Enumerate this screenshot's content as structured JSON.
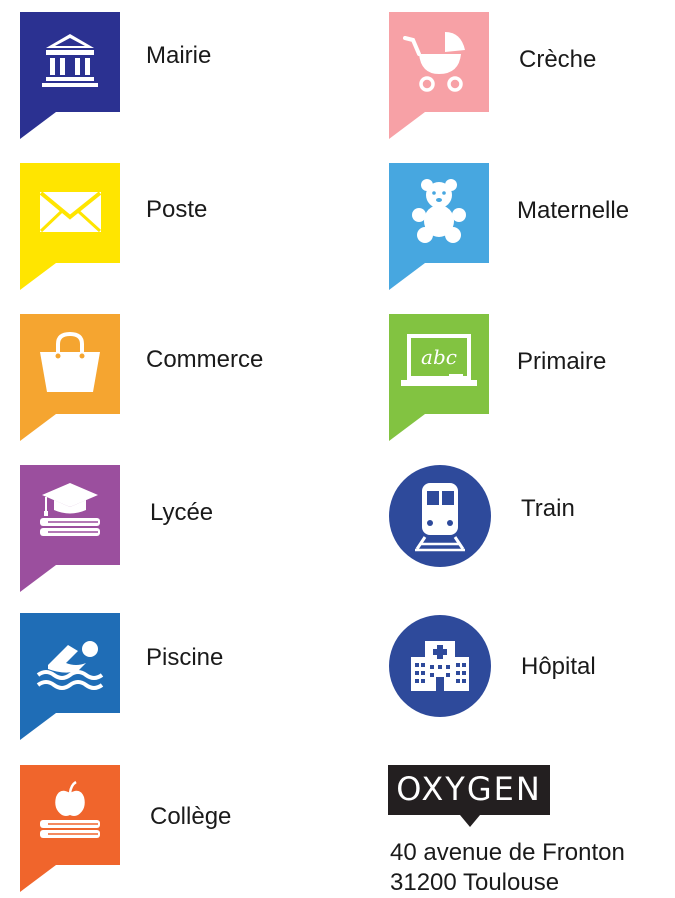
{
  "legend": {
    "left_column": [
      {
        "label": "Mairie",
        "icon": "city-hall-icon",
        "color": "#2b3191"
      },
      {
        "label": "Poste",
        "icon": "envelope-icon",
        "color": "#ffe500"
      },
      {
        "label": "Commerce",
        "icon": "shopping-bag-icon",
        "color": "#f5a530"
      },
      {
        "label": "Lycée",
        "icon": "graduation-books-icon",
        "color": "#9b4f9e"
      },
      {
        "label": "Piscine",
        "icon": "swimmer-icon",
        "color": "#1f6db6"
      },
      {
        "label": "Collège",
        "icon": "apple-books-icon",
        "color": "#f0652c"
      }
    ],
    "right_column": [
      {
        "label": "Crèche",
        "icon": "stroller-icon",
        "color": "#f7a1a6"
      },
      {
        "label": "Maternelle",
        "icon": "teddy-bear-icon",
        "color": "#47a7e0"
      },
      {
        "label": "Primaire",
        "icon": "chalkboard-icon",
        "color": "#82c341",
        "board_text": "abc"
      },
      {
        "label": "Train",
        "icon": "train-icon",
        "color": "#2e4a9b"
      },
      {
        "label": "Hôpital",
        "icon": "hospital-icon",
        "color": "#2e4a9b"
      }
    ]
  },
  "brand": {
    "name": "OXYGEN",
    "color": "#231f20"
  },
  "address": {
    "line1": "40 avenue de Fronton",
    "line2": "31200 Toulouse"
  }
}
